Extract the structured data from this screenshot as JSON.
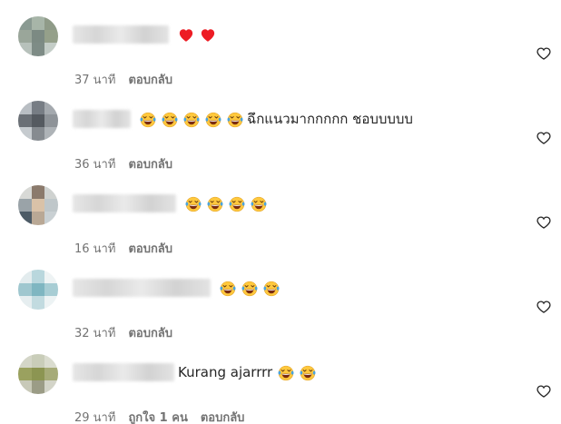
{
  "colors": {
    "text": "#262626",
    "muted": "#737373",
    "heart_red": "#ed1c24",
    "emoji_face": "#ffc83d"
  },
  "comments": [
    {
      "text": "",
      "emojis": [
        "heart-red",
        "heart-red"
      ],
      "time": "37 นาที",
      "likes": "",
      "reply": "ตอบกลับ",
      "avatar": [
        "#8a9a92",
        "#a7b5a8",
        "#8f9b88",
        "#9aa69a",
        "#7c8a83",
        "#95a08a",
        "#b7c1bb",
        "#7e8c86",
        "#c4cdc7"
      ]
    },
    {
      "text": "ฉึกแนวมากกกกก ชอบบบบบ",
      "emojis": [
        "laughing-face",
        "laughing-face",
        "laughing-face",
        "laughing-face",
        "laughing-face"
      ],
      "time": "36 นาที",
      "likes": "",
      "reply": "ตอบกลับ",
      "avatar": [
        "#b9bec3",
        "#777d84",
        "#a4a9ae",
        "#6b7076",
        "#555a60",
        "#8e9398",
        "#c6cbcf",
        "#868b90",
        "#aeb3b7"
      ]
    },
    {
      "text": "",
      "emojis": [
        "laughing-face",
        "laughing-face",
        "laughing-face",
        "laughing-face"
      ],
      "time": "16 นาที",
      "likes": "",
      "reply": "ตอบกลับ",
      "avatar": [
        "#d8d9d6",
        "#8b7a6c",
        "#cfd2d0",
        "#9aa3a8",
        "#d9c2a8",
        "#bfc7ca",
        "#4d5b66",
        "#b9a895",
        "#c9d0d3"
      ]
    },
    {
      "text": "",
      "emojis": [
        "laughing-face",
        "laughing-face",
        "laughing-face"
      ],
      "time": "32 นาที",
      "likes": "",
      "reply": "ตอบกลับ",
      "avatar": [
        "#e3ecee",
        "#b9d7dd",
        "#eef3f4",
        "#9fc7cf",
        "#7fb6c1",
        "#a7cdd4",
        "#e6eef0",
        "#c2dbe0",
        "#edf3f4"
      ]
    },
    {
      "text": "Kurang ajarrrr",
      "emojis": [
        "laughing-face",
        "laughing-face"
      ],
      "time": "29 นาที",
      "likes": "ถูกใจ 1 คน",
      "reply": "ตอบกลับ",
      "avatar": [
        "#d4d6c8",
        "#c9cdb9",
        "#dadccf",
        "#9aa15f",
        "#8c9552",
        "#a6ab78",
        "#c8c9b8",
        "#9b9c86",
        "#d3d4c8"
      ]
    }
  ]
}
